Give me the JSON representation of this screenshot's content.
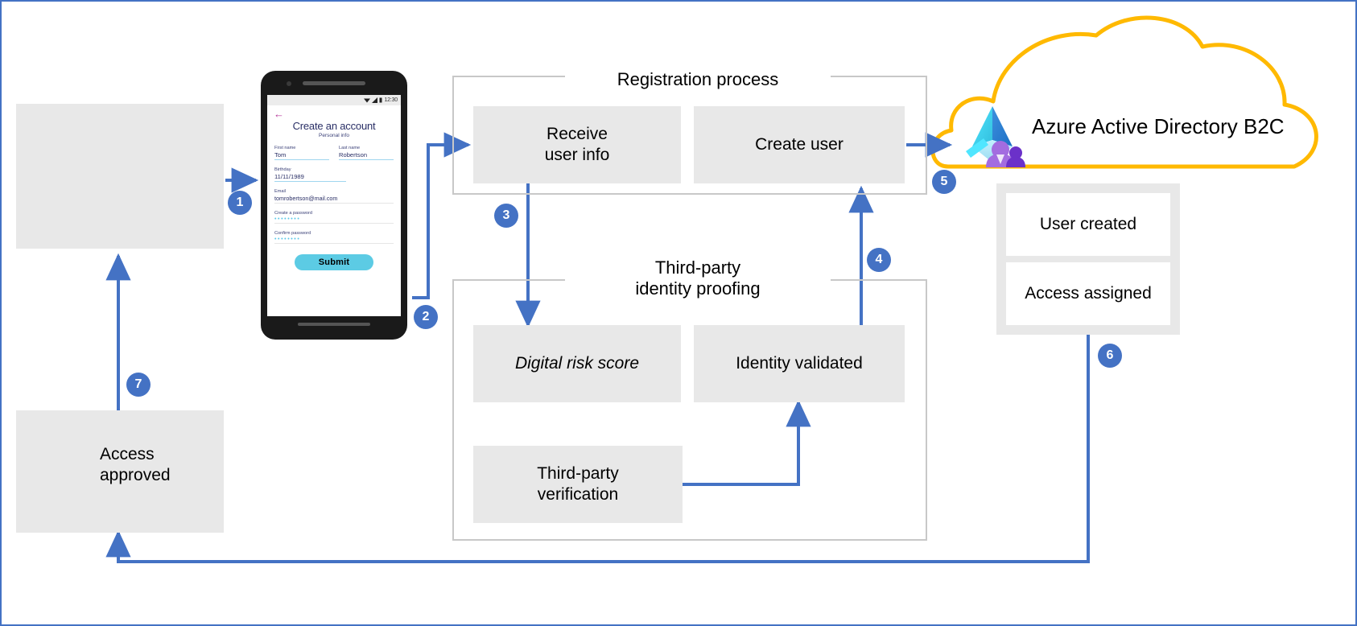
{
  "diagram": {
    "title": "Azure AD B2C registration with third-party identity proofing",
    "accent_blue": "#4472C4",
    "cloud_yellow": "#FFB900",
    "box_grey": "#E8E8E8",
    "frame_grey": "#C8C8C8"
  },
  "user_box": {
    "icon": "person-icon"
  },
  "phone": {
    "status_time": "12:30",
    "back_icon": "back-arrow-icon",
    "wifi_icon": "wifi-icon",
    "signal_icon": "signal-icon",
    "battery_icon": "battery-icon",
    "form_title": "Create an account",
    "form_subtitle": "Personal info",
    "fields": [
      {
        "label": "First name",
        "value": "Tom"
      },
      {
        "label": "Last name",
        "value": "Robertson"
      },
      {
        "label": "Birthday",
        "value": "11/11/1989"
      },
      {
        "label": "Email",
        "value": "tomrobertson@mail.com"
      },
      {
        "label": "Create a password",
        "value": "••••••••"
      },
      {
        "label": "Confirm password",
        "value": "••••••••"
      }
    ],
    "submit_label": "Submit"
  },
  "registration": {
    "group_title": "Registration process",
    "boxes": [
      {
        "label": "Receive\nuser info",
        "line1": "Receive",
        "line2": "user info"
      },
      {
        "label": "Create user",
        "line1": "Create user",
        "line2": ""
      }
    ]
  },
  "third_party": {
    "group_title_line1": "Third-party",
    "group_title_line2": "identity proofing",
    "boxes": [
      {
        "label": "Digital risk score",
        "style": "italic"
      },
      {
        "label": "Identity validated",
        "style": "normal"
      },
      {
        "line1": "Third-party",
        "line2": "verification",
        "style": "normal"
      }
    ]
  },
  "cloud": {
    "label": "Azure Active Directory B2C",
    "logo": "azure-ad-b2c-logo"
  },
  "results": {
    "boxes": [
      {
        "label": "User created"
      },
      {
        "label": "Access assigned"
      }
    ]
  },
  "access_approved": {
    "icon": "envelope-icon",
    "line1": "Access",
    "line2": "approved"
  },
  "steps": [
    {
      "number": "1"
    },
    {
      "number": "2"
    },
    {
      "number": "3"
    },
    {
      "number": "4"
    },
    {
      "number": "5"
    },
    {
      "number": "6"
    },
    {
      "number": "7"
    }
  ]
}
